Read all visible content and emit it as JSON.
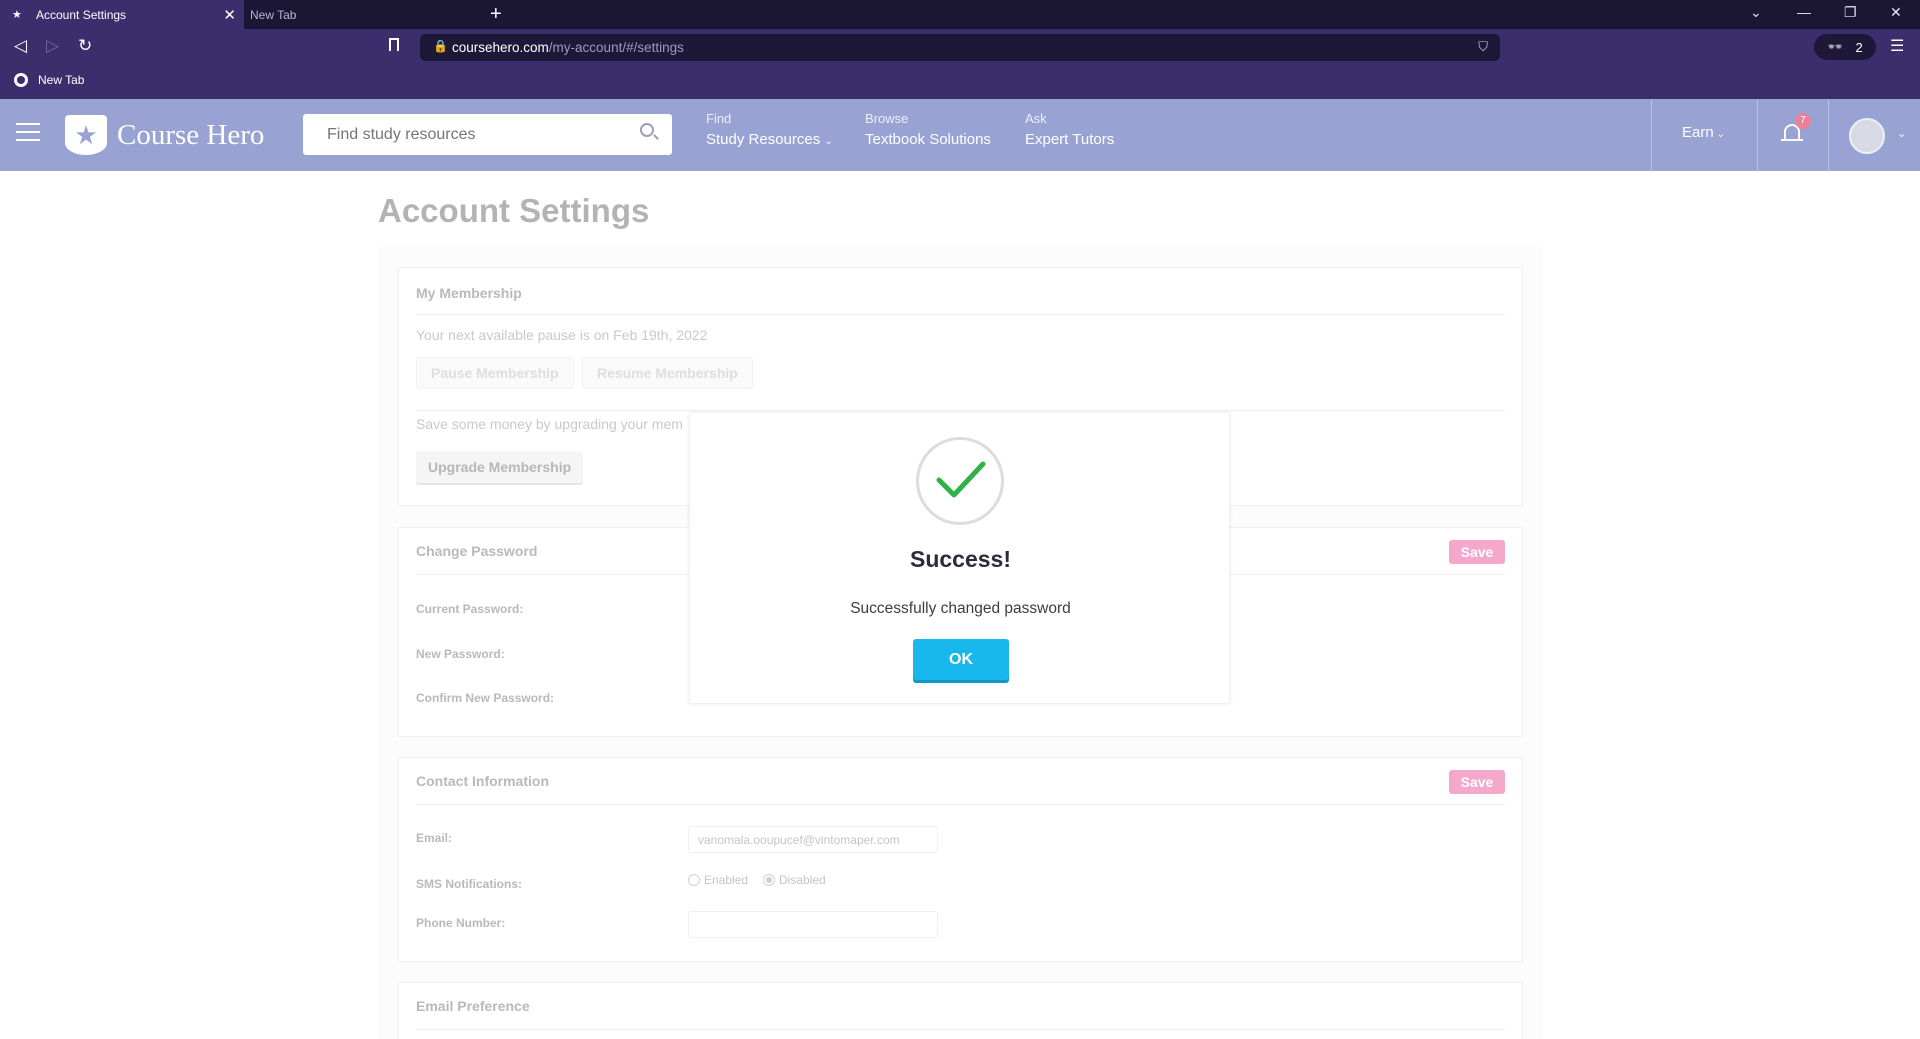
{
  "browser": {
    "tabs": [
      {
        "label": "Account Settings",
        "active": true
      },
      {
        "label": "New Tab",
        "active": false
      }
    ],
    "address": {
      "domain": "coursehero.com",
      "path": "/my-account/#/settings"
    },
    "extension_count": "2",
    "bookmarks": [
      {
        "label": "New Tab"
      }
    ]
  },
  "header": {
    "brand": "Course Hero",
    "search_placeholder": "Find study resources",
    "nav": [
      {
        "small": "Find",
        "big": "Study Resources"
      },
      {
        "small": "Browse",
        "big": "Textbook Solutions"
      },
      {
        "small": "Ask",
        "big": "Expert Tutors"
      }
    ],
    "earn": "Earn",
    "notification_count": "7"
  },
  "page": {
    "title": "Account Settings",
    "membership": {
      "title": "My Membership",
      "pause_note": "Your next available pause is on Feb 19th, 2022",
      "pause_button": "Pause Membership",
      "resume_button": "Resume Membership",
      "upgrade_note": "Save some money by upgrading your mem",
      "upgrade_button": "Upgrade Membership"
    },
    "password": {
      "title": "Change Password",
      "save": "Save",
      "current_label": "Current Password:",
      "new_label": "New Password:",
      "confirm_label": "Confirm New Password:"
    },
    "contact": {
      "title": "Contact Information",
      "save": "Save",
      "email_label": "Email:",
      "email_value": "vanomala.ooupucef@vintomaper.com",
      "sms_label": "SMS Notifications:",
      "sms_enabled": "Enabled",
      "sms_disabled": "Disabled",
      "phone_label": "Phone Number:"
    },
    "email_pref": {
      "title": "Email Preference"
    }
  },
  "modal": {
    "title": "Success!",
    "message": "Successfully changed password",
    "ok": "OK"
  },
  "colors": {
    "header_bg": "#98a2d3",
    "browser_chrome": "#3a2f6c",
    "ok_button": "#18b8ec",
    "save_button": "#f4a8cb",
    "check": "#2fb24a"
  },
  "icons": [
    "star-icon",
    "close-icon",
    "plus-icon",
    "back-icon",
    "forward-icon",
    "reload-icon",
    "bookmark-icon",
    "lock-icon",
    "globe-icon",
    "search-icon",
    "bell-icon",
    "check-icon",
    "menu-icon"
  ]
}
